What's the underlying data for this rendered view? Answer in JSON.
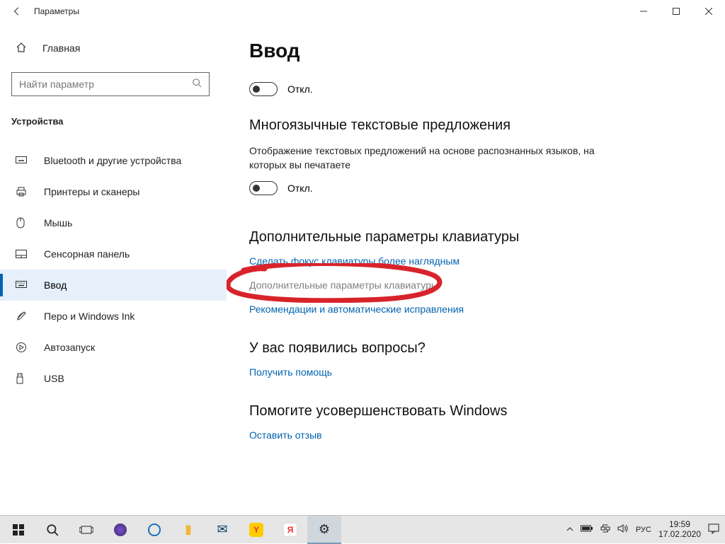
{
  "title": "Параметры",
  "home_label": "Главная",
  "search_placeholder": "Найти параметр",
  "group_label": "Устройства",
  "nav": [
    {
      "label": "Bluetooth и другие устройства"
    },
    {
      "label": "Принтеры и сканеры"
    },
    {
      "label": "Мышь"
    },
    {
      "label": "Сенсорная панель"
    },
    {
      "label": "Ввод"
    },
    {
      "label": "Перо и Windows Ink"
    },
    {
      "label": "Автозапуск"
    },
    {
      "label": "USB"
    }
  ],
  "page_heading": "Ввод",
  "toggle1_label": "Откл.",
  "multilang_heading": "Многоязычные текстовые предложения",
  "multilang_desc": "Отображение текстовых предложений на основе распознанных языков, на которых вы печатаете",
  "toggle2_label": "Откл.",
  "advanced_heading": "Дополнительные параметры клавиатуры",
  "link_focus": "Сделать фокус клавиатуры более наглядным",
  "link_advanced": "Дополнительные параметры клавиатуры",
  "link_recommend": "Рекомендации и автоматические исправления",
  "questions_heading": "У вас появились вопросы?",
  "link_help": "Получить помощь",
  "improve_heading": "Помогите усовершенствовать Windows",
  "link_feedback": "Оставить отзыв",
  "tray": {
    "lang": "РУС",
    "time": "19:59",
    "date": "17.02.2020"
  }
}
